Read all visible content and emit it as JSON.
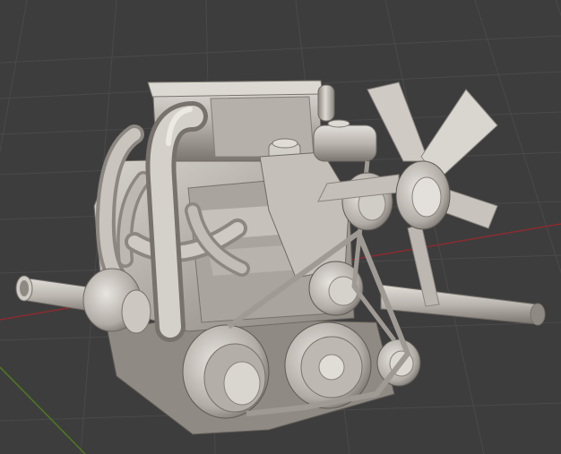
{
  "viewport": {
    "mode": "3d-viewport",
    "shading": "solid",
    "object": "engine-model",
    "show_grid": true,
    "axes_visible": [
      "x-axis",
      "y-axis"
    ]
  },
  "colors": {
    "background": "#3d3d3d",
    "grid_line": "#4a4a4a",
    "x_axis": "#8b2b30",
    "y_axis": "#4d7a1e",
    "material_base": "#b9b4ae",
    "material_light": "#dedad5",
    "material_shadow": "#6f6a65"
  }
}
